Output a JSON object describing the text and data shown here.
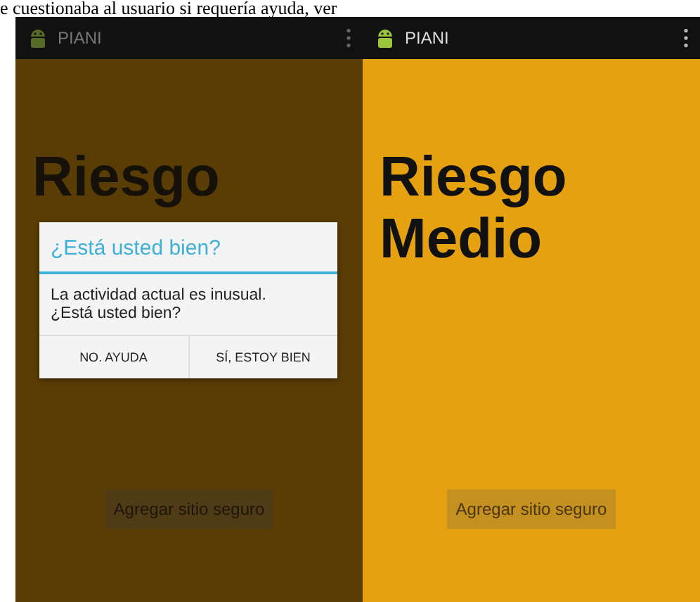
{
  "caption": "e cuestionaba al usuario si requería ayuda, ver",
  "screens": [
    {
      "app_title": "PIANI",
      "dimmed": true,
      "risk_title": [
        "Riesgo"
      ],
      "button": "Agregar sitio seguro",
      "dialog": {
        "title": "¿Está usted bien?",
        "message": "La actividad actual es inusual. ¿Está usted bien?",
        "buttons": [
          "NO. AYUDA",
          "SÍ, ESTOY BIEN"
        ]
      }
    },
    {
      "app_title": "PIANI",
      "dimmed": false,
      "risk_title": [
        "Riesgo",
        "Medio"
      ],
      "button": "Agregar sitio seguro"
    }
  ]
}
